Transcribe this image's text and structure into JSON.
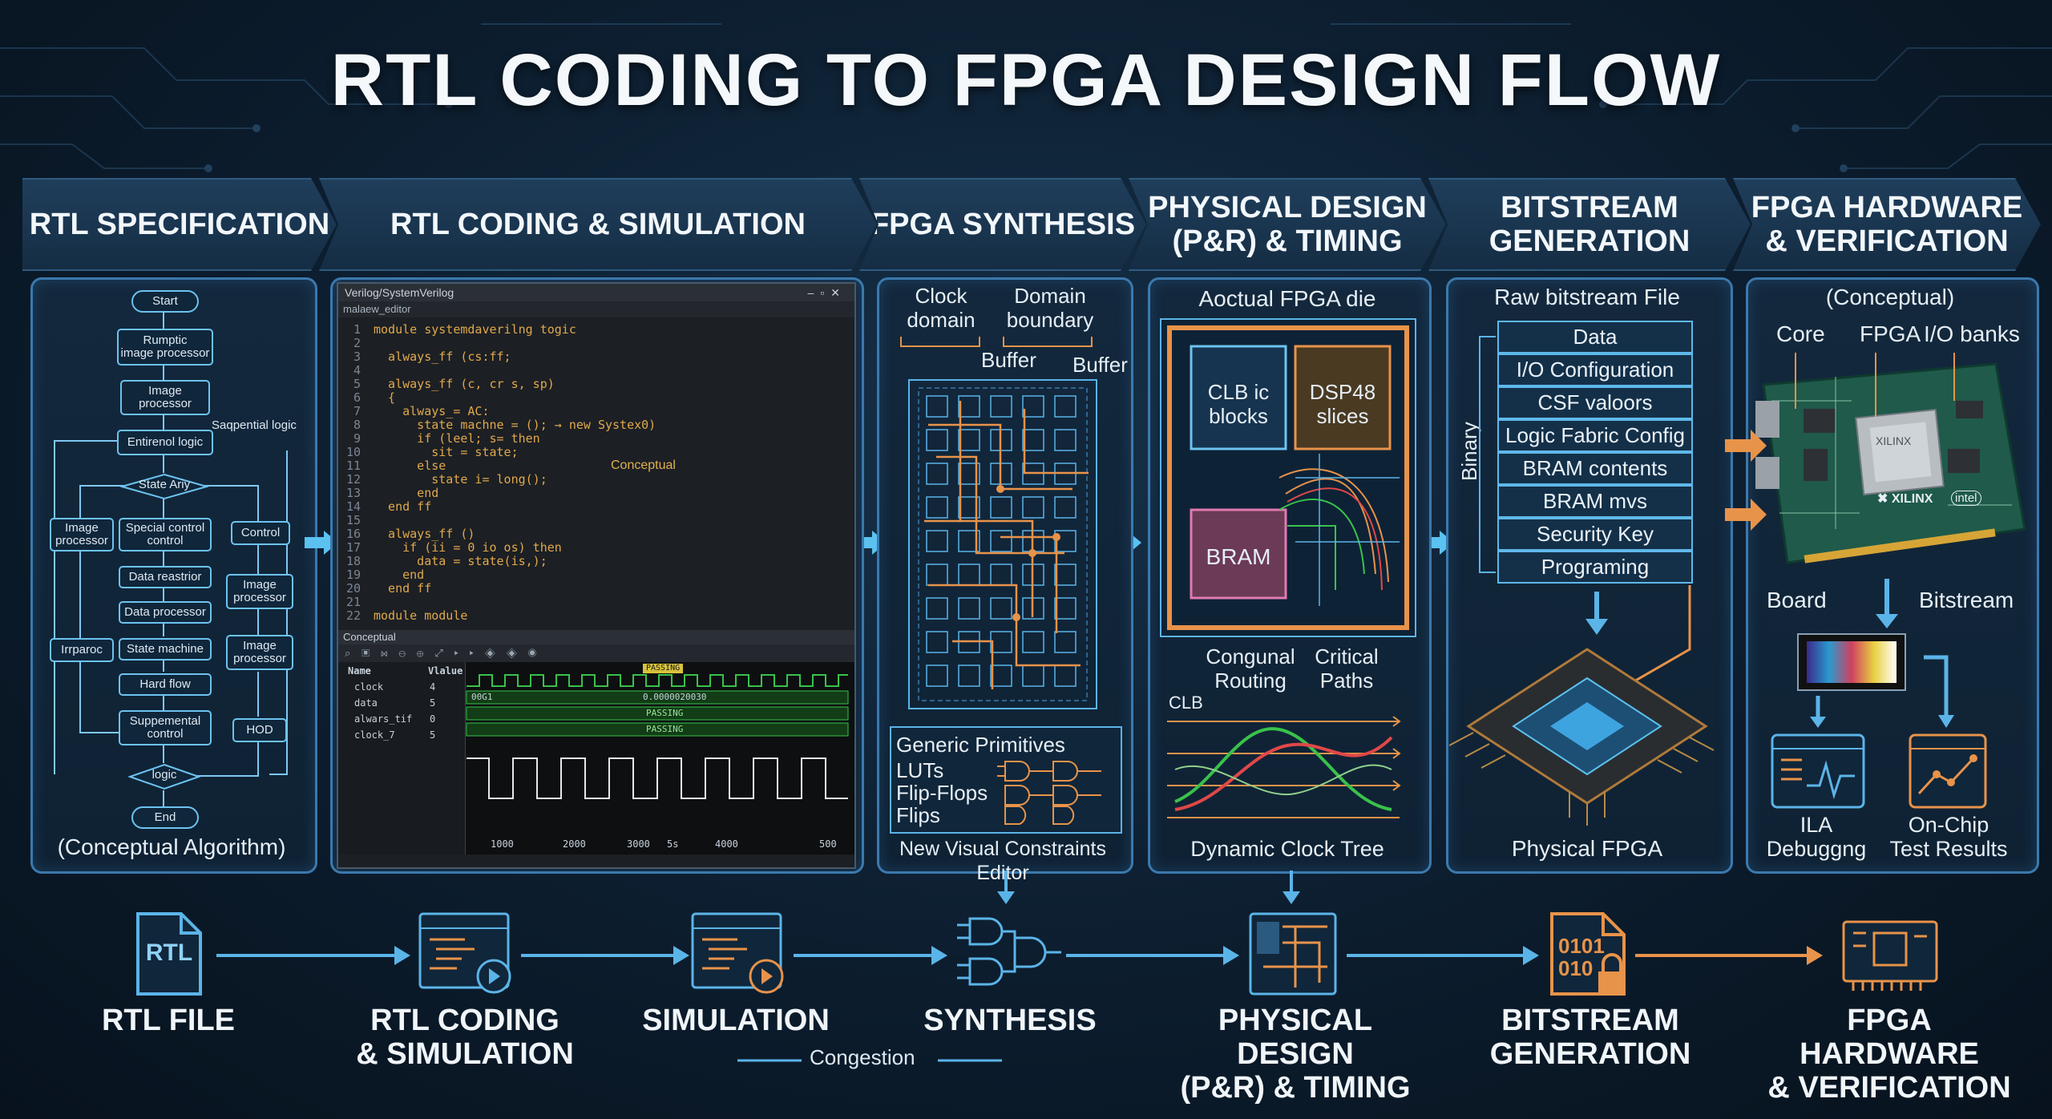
{
  "title": "RTL CODING TO FPGA DESIGN FLOW",
  "stages": [
    {
      "header": "RTL SPECIFICATION"
    },
    {
      "header": "RTL CODING & SIMULATION"
    },
    {
      "header": "FPGA SYNTHESIS"
    },
    {
      "header": "PHYSICAL DESIGN\n(P&R) & TIMING"
    },
    {
      "header": "BITSTREAM\nGENERATION"
    },
    {
      "header": "FPGA HARDWARE\n& VERIFICATION"
    }
  ],
  "spec": {
    "nodes": {
      "start": "Start",
      "rumptic": "Rumptic\nimage processor",
      "image_processor": "Image\nprocessor",
      "entirenol": "Entirenol logic",
      "state_ariy": "State Ariy",
      "image_processor_left": "Image\nprocessor",
      "special_control": "Special control\ncontrol",
      "control": "Control",
      "data_reastrior": "Data reastrior",
      "image_processor_r1": "Image\nprocessor",
      "data_processor": "Data processor",
      "irrparoc": "Irrparoc",
      "state_machine": "State machine",
      "image_processor_r2": "Image\nprocessor",
      "hard_flow": "Hard flow",
      "suppemental": "Suppemental\ncontrol",
      "hod": "HOD",
      "logic": "logic",
      "end": "End"
    },
    "sequential_label": "Saqpential logic",
    "caption": "(Conceptual Algorithm)"
  },
  "editor": {
    "title": "Verilog/SystemVerilog",
    "tab": "malaew_editor",
    "lines": [
      {
        "n": "1",
        "t": "module systemdaverilng togic"
      },
      {
        "n": "2",
        "t": ""
      },
      {
        "n": "3",
        "t": "  always_ff (cs:ff;"
      },
      {
        "n": "4",
        "t": ""
      },
      {
        "n": "5",
        "t": "  always_ff (c, cr s, sp)"
      },
      {
        "n": "6",
        "t": "  {"
      },
      {
        "n": "7",
        "t": "    always_= AC:"
      },
      {
        "n": "8",
        "t": "      state machne = (); → new Systex0)"
      },
      {
        "n": "9",
        "t": "      if (leel; s= then"
      },
      {
        "n": "10",
        "t": "        sit = state;"
      },
      {
        "n": "11",
        "t": "      else"
      },
      {
        "n": "12",
        "t": "        state i= long();"
      },
      {
        "n": "13",
        "t": "      end"
      },
      {
        "n": "14",
        "t": "  end ff"
      },
      {
        "n": "15",
        "t": ""
      },
      {
        "n": "16",
        "t": "  always_ff ()"
      },
      {
        "n": "17",
        "t": "    if (ii = 0 io os) then"
      },
      {
        "n": "18",
        "t": "      data = state(is,);"
      },
      {
        "n": "19",
        "t": "    end"
      },
      {
        "n": "20",
        "t": "  end ff"
      },
      {
        "n": "21",
        "t": ""
      },
      {
        "n": "22",
        "t": "module module"
      }
    ],
    "conceptual_note": "Conceptual",
    "sim_header": "Conceptual",
    "wave_col_name": "Name",
    "wave_col_value": "Vlalue",
    "signals": [
      {
        "name": "clock",
        "value": "4"
      },
      {
        "name": "data",
        "value": "5"
      },
      {
        "name": "alwars_tif",
        "value": "0"
      },
      {
        "name": "clock_7",
        "value": "5"
      }
    ],
    "passing": "PASSING",
    "bus_value_1": "00G1",
    "bus_value_2": "0.0000020030",
    "axis": [
      "1000",
      "2000",
      "3000",
      "5s",
      "4000",
      "500"
    ]
  },
  "synthesis": {
    "clock_domain": "Clock\ndomain",
    "domain_boundary": "Domain\nboundary",
    "buffer1": "Buffer",
    "buffer2": "Buffer",
    "primitives_title": "Generic Primitives",
    "primitives": [
      "LUTs",
      "Flip-Flops",
      "Flips"
    ],
    "caption": "New Visual Constraints Editor"
  },
  "physical": {
    "title": "Aoctual FPGA die",
    "clb": "CLB ic\nblocks",
    "dsp": "DSP48\nslices",
    "bram": "BRAM",
    "congunal": "Congunal\nRouting",
    "critical": "Critical\nPaths",
    "clb_small": "CLB",
    "caption": "Dynamic Clock Tree"
  },
  "bitstream": {
    "title": "Raw bitstream File",
    "binary": "Binary",
    "rows": [
      "Data",
      "I/O Configuration",
      "CSF valoors",
      "Logic Fabric Config",
      "BRAM contents",
      "BRAM mvs",
      "Security Key",
      "Programing"
    ],
    "caption": "Physical FPGA"
  },
  "hardware": {
    "conceptual": "(Conceptual)",
    "core": "Core",
    "fpga": "FPGA",
    "io_banks": "I/O banks",
    "chip_label": "XILINX",
    "brand": "✖ XILINX",
    "intel": "intel",
    "board": "Board",
    "bitstream": "Bitstream",
    "ila": "ILA\nDebuggng",
    "onchip": "On-Chip\nTest Results"
  },
  "bottom": {
    "rtl_icon": "RTL",
    "labels": [
      "RTL FILE",
      "RTL CODING\n& SIMULATION",
      "SIMULATION",
      "SYNTHESIS",
      "PHYSICAL DESIGN\n(P&R) & TIMING",
      "BITSTREAM\nGENERATION",
      "FPGA HARDWARE\n& VERIFICATION"
    ],
    "congestion": "Congestion",
    "bits_icon": "0101\n010"
  },
  "colors": {
    "accent": "#5bb4e8",
    "orange": "#e8934a",
    "green": "#39c24a",
    "red": "#e04848"
  }
}
